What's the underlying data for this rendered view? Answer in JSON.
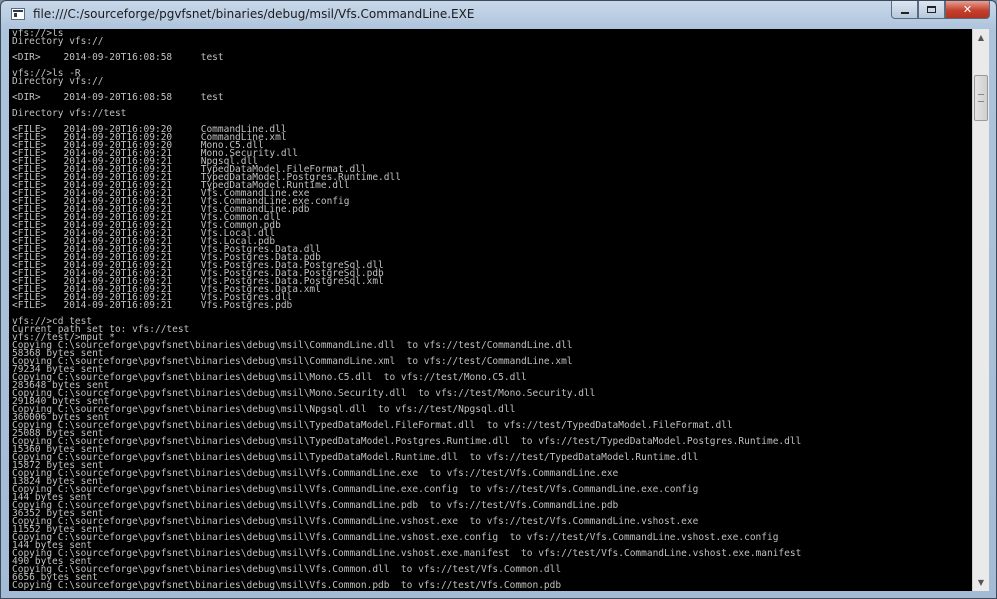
{
  "window": {
    "title": "file:///C:/sourceforge/pgvfsnet/binaries/debug/msil/Vfs.CommandLine.EXE",
    "caption_buttons": {
      "minimize": "minimize-icon",
      "maximize": "maximize-icon",
      "close": "✕"
    }
  },
  "scrollbar": {
    "up_arrow": "▲",
    "down_arrow": "▼"
  },
  "console": {
    "lines": [
      "vfs://>ls",
      "Directory vfs://",
      "",
      "<DIR>    2014-09-20T16:08:58     test",
      "",
      "vfs://>ls -R",
      "Directory vfs://",
      "",
      "<DIR>    2014-09-20T16:08:58     test",
      "",
      "Directory vfs://test",
      "",
      "<FILE>   2014-09-20T16:09:20     CommandLine.dll",
      "<FILE>   2014-09-20T16:09:20     CommandLine.xml",
      "<FILE>   2014-09-20T16:09:20     Mono.C5.dll",
      "<FILE>   2014-09-20T16:09:21     Mono.Security.dll",
      "<FILE>   2014-09-20T16:09:21     Npgsql.dll",
      "<FILE>   2014-09-20T16:09:21     TypedDataModel.FileFormat.dll",
      "<FILE>   2014-09-20T16:09:21     TypedDataModel.Postgres.Runtime.dll",
      "<FILE>   2014-09-20T16:09:21     TypedDataModel.Runtime.dll",
      "<FILE>   2014-09-20T16:09:21     Vfs.CommandLine.exe",
      "<FILE>   2014-09-20T16:09:21     Vfs.CommandLine.exe.config",
      "<FILE>   2014-09-20T16:09:21     Vfs.CommandLine.pdb",
      "<FILE>   2014-09-20T16:09:21     Vfs.Common.dll",
      "<FILE>   2014-09-20T16:09:21     Vfs.Common.pdb",
      "<FILE>   2014-09-20T16:09:21     Vfs.Local.dll",
      "<FILE>   2014-09-20T16:09:21     Vfs.Local.pdb",
      "<FILE>   2014-09-20T16:09:21     Vfs.Postgres.Data.dll",
      "<FILE>   2014-09-20T16:09:21     Vfs.Postgres.Data.pdb",
      "<FILE>   2014-09-20T16:09:21     Vfs.Postgres.Data.PostgreSql.dll",
      "<FILE>   2014-09-20T16:09:21     Vfs.Postgres.Data.PostgreSql.pdb",
      "<FILE>   2014-09-20T16:09:21     Vfs.Postgres.Data.PostgreSql.xml",
      "<FILE>   2014-09-20T16:09:21     Vfs.Postgres.Data.xml",
      "<FILE>   2014-09-20T16:09:21     Vfs.Postgres.dll",
      "<FILE>   2014-09-20T16:09:21     Vfs.Postgres.pdb",
      "",
      "vfs://>cd test",
      "Current path set to: vfs://test",
      "vfs://test/>mput *",
      "Copying C:\\sourceforge\\pgvfsnet\\binaries\\debug\\msil\\CommandLine.dll  to vfs://test/CommandLine.dll",
      "58368 bytes sent",
      "Copying C:\\sourceforge\\pgvfsnet\\binaries\\debug\\msil\\CommandLine.xml  to vfs://test/CommandLine.xml",
      "79234 bytes sent",
      "Copying C:\\sourceforge\\pgvfsnet\\binaries\\debug\\msil\\Mono.C5.dll  to vfs://test/Mono.C5.dll",
      "283648 bytes sent",
      "Copying C:\\sourceforge\\pgvfsnet\\binaries\\debug\\msil\\Mono.Security.dll  to vfs://test/Mono.Security.dll",
      "291840 bytes sent",
      "Copying C:\\sourceforge\\pgvfsnet\\binaries\\debug\\msil\\Npgsql.dll  to vfs://test/Npgsql.dll",
      "360006 bytes sent",
      "Copying C:\\sourceforge\\pgvfsnet\\binaries\\debug\\msil\\TypedDataModel.FileFormat.dll  to vfs://test/TypedDataModel.FileFormat.dll",
      "25088 bytes sent",
      "Copying C:\\sourceforge\\pgvfsnet\\binaries\\debug\\msil\\TypedDataModel.Postgres.Runtime.dll  to vfs://test/TypedDataModel.Postgres.Runtime.dll",
      "15360 bytes sent",
      "Copying C:\\sourceforge\\pgvfsnet\\binaries\\debug\\msil\\TypedDataModel.Runtime.dll  to vfs://test/TypedDataModel.Runtime.dll",
      "15872 bytes sent",
      "Copying C:\\sourceforge\\pgvfsnet\\binaries\\debug\\msil\\Vfs.CommandLine.exe  to vfs://test/Vfs.CommandLine.exe",
      "13824 bytes sent",
      "Copying C:\\sourceforge\\pgvfsnet\\binaries\\debug\\msil\\Vfs.CommandLine.exe.config  to vfs://test/Vfs.CommandLine.exe.config",
      "144 bytes sent",
      "Copying C:\\sourceforge\\pgvfsnet\\binaries\\debug\\msil\\Vfs.CommandLine.pdb  to vfs://test/Vfs.CommandLine.pdb",
      "36352 bytes sent",
      "Copying C:\\sourceforge\\pgvfsnet\\binaries\\debug\\msil\\Vfs.CommandLine.vshost.exe  to vfs://test/Vfs.CommandLine.vshost.exe",
      "11552 bytes sent",
      "Copying C:\\sourceforge\\pgvfsnet\\binaries\\debug\\msil\\Vfs.CommandLine.vshost.exe.config  to vfs://test/Vfs.CommandLine.vshost.exe.config",
      "144 bytes sent",
      "Copying C:\\sourceforge\\pgvfsnet\\binaries\\debug\\msil\\Vfs.CommandLine.vshost.exe.manifest  to vfs://test/Vfs.CommandLine.vshost.exe.manifest",
      "490 bytes sent",
      "Copying C:\\sourceforge\\pgvfsnet\\binaries\\debug\\msil\\Vfs.Common.dll  to vfs://test/Vfs.Common.dll",
      "6656 bytes sent",
      "Copying C:\\sourceforge\\pgvfsnet\\binaries\\debug\\msil\\Vfs.Common.pdb  to vfs://test/Vfs.Common.pdb"
    ]
  }
}
